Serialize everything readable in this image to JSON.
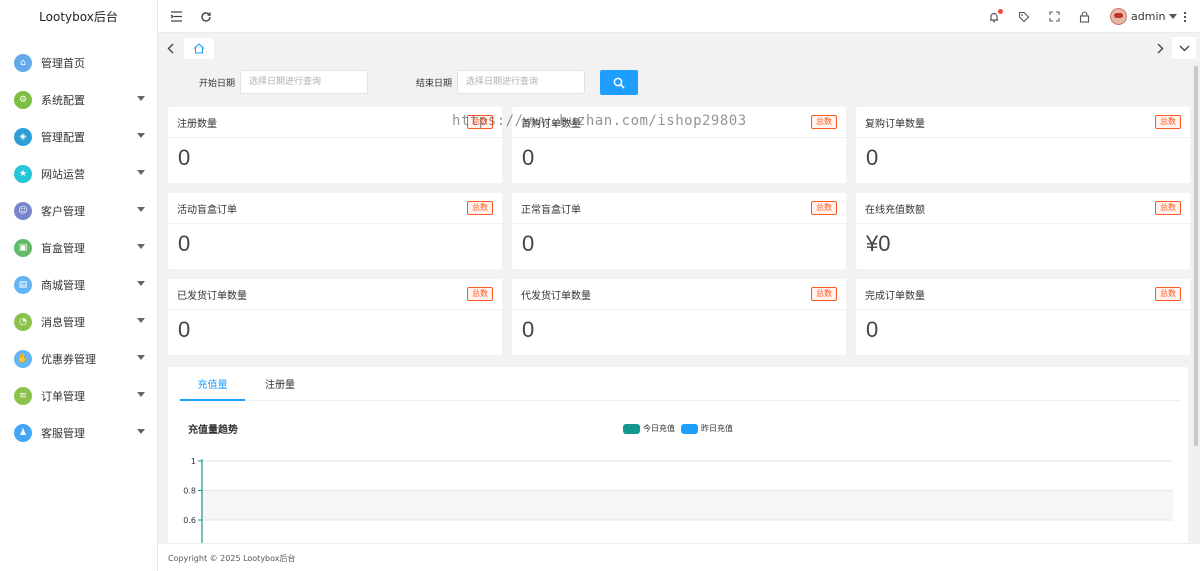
{
  "app": {
    "title": "Lootybox后台"
  },
  "sidebar": {
    "items": [
      {
        "label": "管理首页",
        "icon": "home-icon",
        "color": "#62a8ea",
        "glyph": "⌂",
        "has_caret": false
      },
      {
        "label": "系统配置",
        "icon": "gear-icon",
        "color": "#7bc043",
        "glyph": "⚙",
        "has_caret": true
      },
      {
        "label": "管理配置",
        "icon": "shield-icon",
        "color": "#2e9fd6",
        "glyph": "◈",
        "has_caret": true
      },
      {
        "label": "网站运营",
        "icon": "star-icon",
        "color": "#26c6da",
        "glyph": "★",
        "has_caret": true
      },
      {
        "label": "客户管理",
        "icon": "user-icon",
        "color": "#7986cb",
        "glyph": "☺",
        "has_caret": true
      },
      {
        "label": "盲盒管理",
        "icon": "box-icon",
        "color": "#66bb6a",
        "glyph": "▣",
        "has_caret": true
      },
      {
        "label": "商城管理",
        "icon": "cart-icon",
        "color": "#64b5f6",
        "glyph": "▤",
        "has_caret": true
      },
      {
        "label": "消息管理",
        "icon": "bell-icon",
        "color": "#8bc34a",
        "glyph": "◔",
        "has_caret": true
      },
      {
        "label": "优惠券管理",
        "icon": "coupon-icon",
        "color": "#64b5f6",
        "glyph": "✋",
        "has_caret": true
      },
      {
        "label": "订单管理",
        "icon": "order-icon",
        "color": "#8bc34a",
        "glyph": "≡",
        "has_caret": true
      },
      {
        "label": "客服管理",
        "icon": "service-icon",
        "color": "#42a5f5",
        "glyph": "♟",
        "has_caret": true
      }
    ]
  },
  "header": {
    "user_name": "admin",
    "notification_dot_color": "#f4453a"
  },
  "filter": {
    "start_label": "开始日期",
    "start_placeholder": "选择日期进行查询",
    "end_label": "结束日期",
    "end_placeholder": "选择日期进行查询"
  },
  "cards": [
    {
      "title": "注册数量",
      "badge": "总数",
      "value": "0"
    },
    {
      "title": "首购订单数量",
      "badge": "总数",
      "value": "0"
    },
    {
      "title": "复购订单数量",
      "badge": "总数",
      "value": "0"
    },
    {
      "title": "活动盲盒订单",
      "badge": "总数",
      "value": "0"
    },
    {
      "title": "正常盲盒订单",
      "badge": "总数",
      "value": "0"
    },
    {
      "title": "在线充值数额",
      "badge": "总数",
      "value": "¥0"
    },
    {
      "title": "已发货订单数量",
      "badge": "总数",
      "value": "0"
    },
    {
      "title": "代发货订单数量",
      "badge": "总数",
      "value": "0"
    },
    {
      "title": "完成订单数量",
      "badge": "总数",
      "value": "0"
    }
  ],
  "chart_tabs": [
    "充值量",
    "注册量"
  ],
  "chart_data": {
    "type": "line",
    "title": "充值量趋势",
    "series": [
      {
        "name": "今日充值",
        "color": "#13978e",
        "values": []
      },
      {
        "name": "昨日充值",
        "color": "#1e9fff",
        "values": []
      }
    ],
    "yticks": [
      "1",
      "0.8",
      "0.6"
    ],
    "ylim": [
      0,
      1
    ],
    "grid": true
  },
  "footer": {
    "text": "Copyright © 2025 Lootybox后台"
  },
  "watermark": "https://www.huzhan.com/ishop29803"
}
